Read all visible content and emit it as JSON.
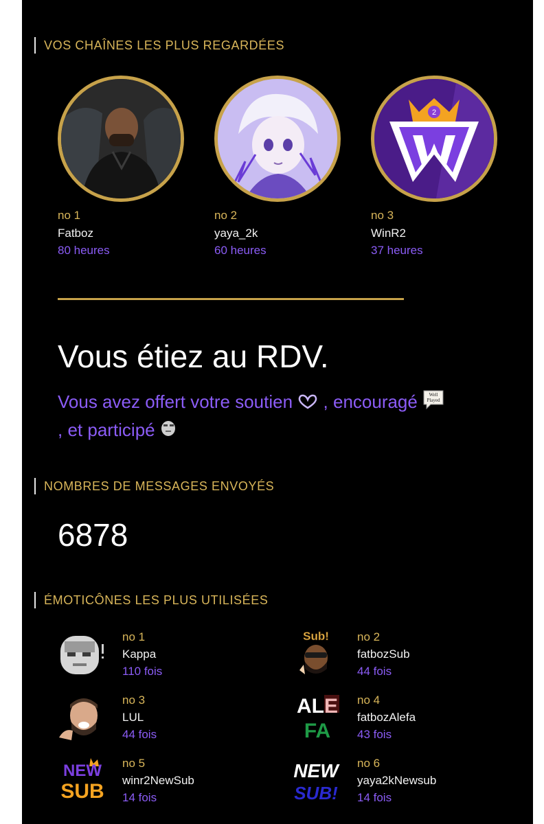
{
  "sections": {
    "channels_title": "VOS CHAÎNES LES PLUS REGARDÉES",
    "messages_title": "NOMBRES DE MESSAGES ENVOYÉS",
    "emotes_title": "ÉMOTICÔNES LES PLUS UTILISÉES"
  },
  "channels": [
    {
      "rank": "no 1",
      "name": "Fatboz",
      "hours": "80 heures"
    },
    {
      "rank": "no 2",
      "name": "yaya_2k",
      "hours": "60 heures"
    },
    {
      "rank": "no 3",
      "name": "WinR2",
      "hours": "37 heures"
    }
  ],
  "headline": "Vous étiez au RDV.",
  "support": {
    "part1": "Vous avez offert votre soutien ",
    "part2": ", encouragé ",
    "part3": ", et participé",
    "badge_text_1": "Well",
    "badge_text_2": "Played"
  },
  "messages_count": "6878",
  "emotes": [
    {
      "rank": "no 1",
      "name": "Kappa",
      "count": "110 fois"
    },
    {
      "rank": "no 2",
      "name": "fatbozSub",
      "count": "44 fois",
      "label": "Sub!"
    },
    {
      "rank": "no 3",
      "name": "LUL",
      "count": "44 fois"
    },
    {
      "rank": "no 4",
      "name": "fatbozAlefa",
      "count": "43 fois",
      "label_1": "ALE",
      "label_2": "FA"
    },
    {
      "rank": "no 5",
      "name": "winr2NewSub",
      "count": "14 fois",
      "label_1": "NEW",
      "label_2": "SUB"
    },
    {
      "rank": "no 6",
      "name": "yaya2kNewsub",
      "count": "14 fois",
      "label_1": "NEW",
      "label_2": "SUB!"
    }
  ],
  "colors": {
    "background": "#000000",
    "gold": "#d9b65a",
    "purple": "#8b5cf6",
    "text": "#f2f2f2"
  }
}
